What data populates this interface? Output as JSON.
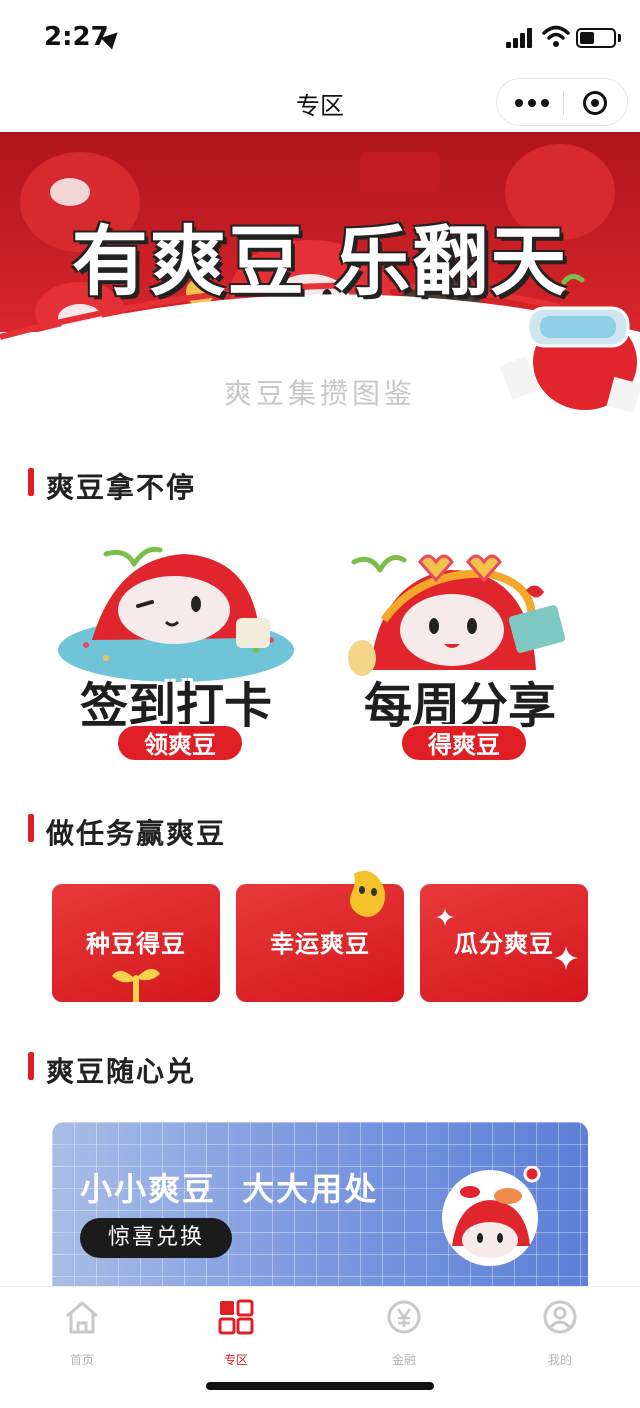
{
  "status_bar": {
    "time": "2:27"
  },
  "nav": {
    "title": "专区"
  },
  "banner": {
    "headline": "有爽豆 乐翻天",
    "subtitle": "爽豆集攒图鉴"
  },
  "sections": {
    "earn": "爽豆拿不停",
    "tasks": "做任务赢爽豆",
    "redeem": "爽豆随心兑"
  },
  "features": [
    {
      "label": "签到打卡",
      "pill": "领爽豆"
    },
    {
      "label": "每周分享",
      "pill": "得爽豆"
    }
  ],
  "tasks": [
    {
      "label": "种豆得豆"
    },
    {
      "label": "幸运爽豆"
    },
    {
      "label": "瓜分爽豆"
    }
  ],
  "redeem_banner": {
    "title": "小小爽豆  大大用处",
    "button": "惊喜兑换"
  },
  "tab_bar": {
    "items": [
      {
        "label": "首页",
        "icon": "home-icon",
        "active": false
      },
      {
        "label": "专区",
        "icon": "grid-icon",
        "active": true
      },
      {
        "label": "金融",
        "icon": "yuan-icon",
        "active": false
      },
      {
        "label": "我的",
        "icon": "user-icon",
        "active": false
      }
    ]
  },
  "colors": {
    "brand_red": "#e01e25",
    "tab_inactive": "#b4b4b4",
    "redeem_blue": "#5d7fd6"
  }
}
